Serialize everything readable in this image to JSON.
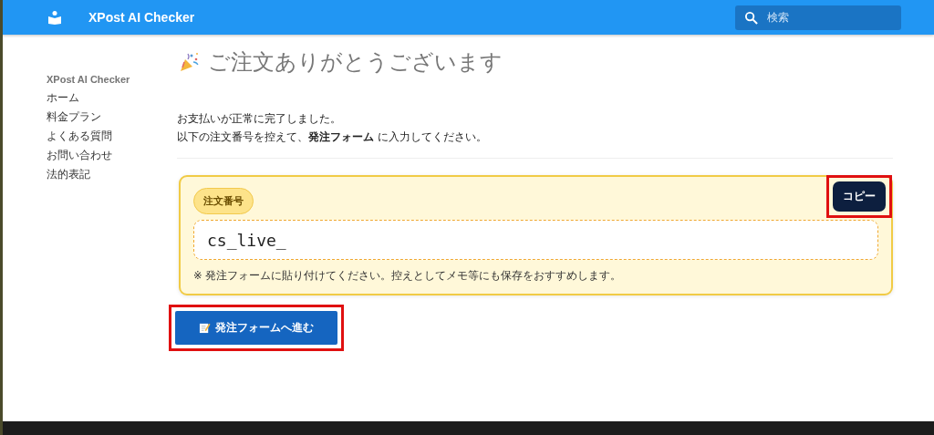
{
  "header": {
    "title": "XPost AI Checker",
    "search": {
      "placeholder": "検索"
    }
  },
  "sidebar": {
    "title": "XPost AI Checker",
    "items": [
      {
        "label": "ホーム"
      },
      {
        "label": "料金プラン"
      },
      {
        "label": "よくある質問"
      },
      {
        "label": "お問い合わせ"
      },
      {
        "label": "法的表記"
      }
    ]
  },
  "main": {
    "title": "ご注文ありがとうございます",
    "paragraphs": [
      "お支払いが正常に完了しました。",
      "以下の注文番号を控えて、**発注フォーム** に入力してください。"
    ],
    "order_card": {
      "badge": "注文番号",
      "copy_button": {
        "label": "コピー",
        "highlighted": true
      },
      "order_number": "cs_live_",
      "note": "※ 発注フォームに貼り付けてください。控えとしてメモ等にも保存をおすすめします。"
    },
    "proceed_button": {
      "label": "発注フォームへ進む",
      "highlighted": true
    }
  }
}
